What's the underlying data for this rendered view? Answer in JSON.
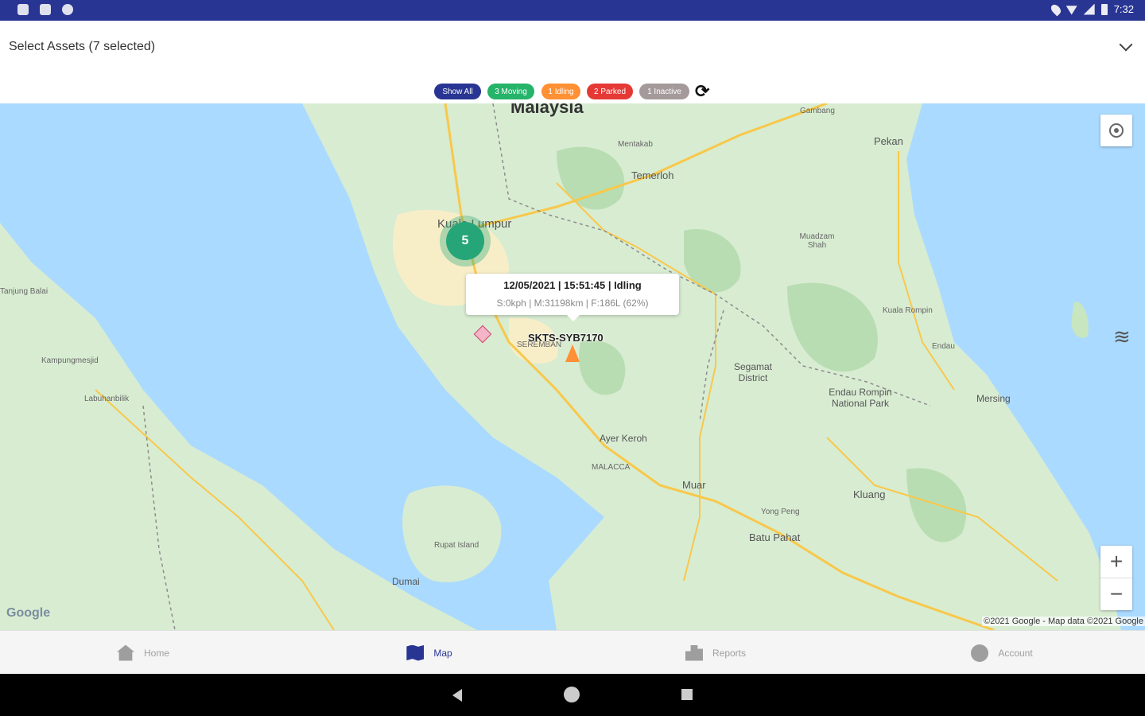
{
  "status_bar": {
    "time": "7:32"
  },
  "asset_selector": {
    "label": "Select Assets (7 selected)"
  },
  "filters": [
    {
      "label": "Show All",
      "color": "#283593"
    },
    {
      "label": "3 Moving",
      "color": "#26b36a"
    },
    {
      "label": "1 Idling",
      "color": "#ff9033"
    },
    {
      "label": "2 Parked",
      "color": "#e53935"
    },
    {
      "label": "1 Inactive",
      "color": "#a59a9a"
    }
  ],
  "map": {
    "labels": {
      "country": "Malaysia",
      "kuala_lumpur": "Kuala Lumpur",
      "gambang": "Gambang",
      "pekan": "Pekan",
      "mentakab": "Mentakab",
      "temerloh": "Temerloh",
      "muadzam": "Muadzam Shah",
      "kuala_rompin": "Kuala Rompin",
      "endau": "Endau",
      "segamat": "Segamat District",
      "endau_rompin": "Endau Rompin National Park",
      "mersing": "Mersing",
      "ayer_keroh": "Ayer Keroh",
      "malacca": "MALACCA",
      "muar": "Muar",
      "kluang": "Kluang",
      "yong_peng": "Yong Peng",
      "batu_pahat": "Batu Pahat",
      "seremban": "SEREMBAN",
      "tanjung_balai": "Tanjung Balai",
      "kampung": "Kampungmesjid",
      "labuhanbilik": "Labuhanbilik",
      "rupat": "Rupat Island",
      "dumai": "Dumai"
    },
    "cluster_count": "5",
    "info_window": {
      "line1": "12/05/2021 | 15:51:45 | Idling",
      "line2": "S:0kph | M:31198km | F:186L (62%)"
    },
    "vehicle_plate": "SKTS-SYB7170",
    "google_logo": "Google",
    "attribution": "©2021 Google - Map data ©2021 Google",
    "zoom_in": "+",
    "zoom_out": "−"
  },
  "bottom_nav": [
    {
      "label": "Home",
      "active": false
    },
    {
      "label": "Map",
      "active": true
    },
    {
      "label": "Reports",
      "active": false
    },
    {
      "label": "Account",
      "active": false
    }
  ]
}
